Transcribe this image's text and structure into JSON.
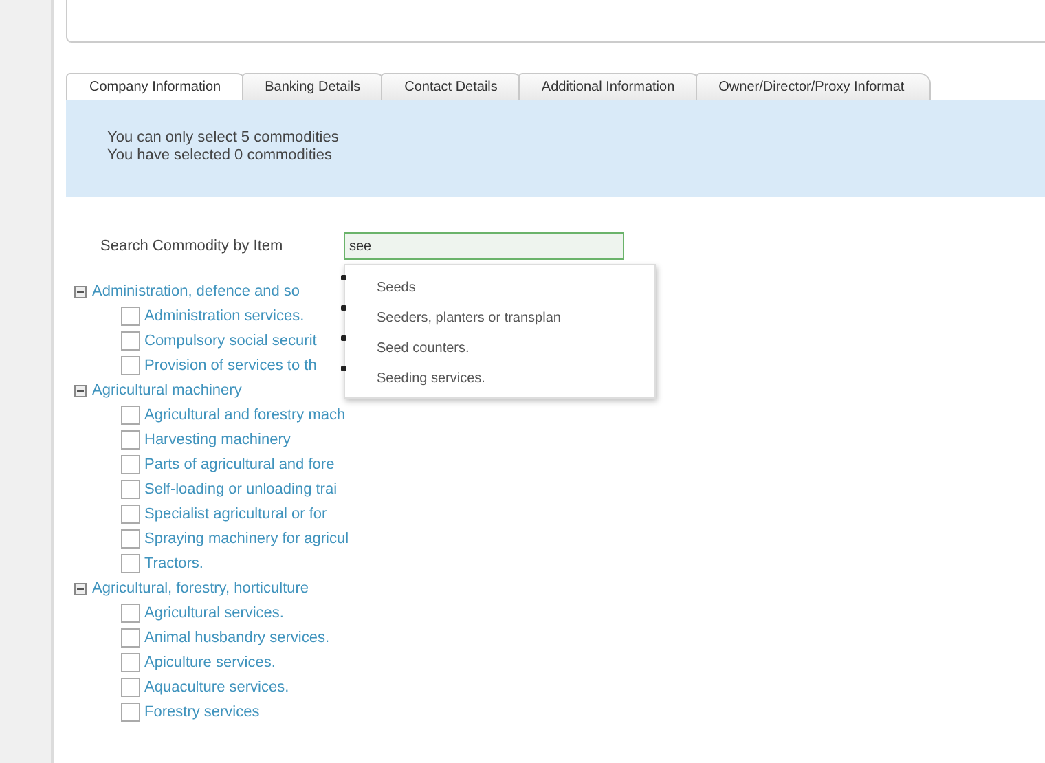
{
  "tabs": [
    {
      "label": "Company Information",
      "selected": true
    },
    {
      "label": "Banking Details",
      "selected": false
    },
    {
      "label": "Contact Details",
      "selected": false
    },
    {
      "label": "Additional Information",
      "selected": false
    },
    {
      "label": "Owner/Director/Proxy Informat",
      "selected": false
    }
  ],
  "info": [
    "You can only select 5 commodities",
    "You have selected 0 commodities"
  ],
  "search": {
    "label": "Search Commodity by Item",
    "value": "see"
  },
  "suggestions": [
    "Seeds",
    "Seeders, planters or transplan",
    "Seed counters.",
    "Seeding services."
  ],
  "tree": [
    {
      "label": "Administration, defence and so",
      "expanded": true,
      "children": [
        {
          "label": "Administration services.",
          "checked": false
        },
        {
          "label": "Compulsory social securit",
          "checked": false
        },
        {
          "label": "Provision of services to th",
          "checked": false
        }
      ]
    },
    {
      "label": "Agricultural machinery",
      "expanded": true,
      "children": [
        {
          "label": "Agricultural and forestry mach",
          "checked": false
        },
        {
          "label": "Harvesting machinery",
          "checked": false
        },
        {
          "label": "Parts of agricultural and fore",
          "checked": false
        },
        {
          "label": "Self-loading or unloading trai",
          "checked": false
        },
        {
          "label": "Specialist agricultural or for",
          "checked": false
        },
        {
          "label": "Spraying machinery for agricul",
          "checked": false
        },
        {
          "label": "Tractors.",
          "checked": false
        }
      ]
    },
    {
      "label": "Agricultural, forestry, horticulture",
      "expanded": true,
      "children": [
        {
          "label": "Agricultural services.",
          "checked": false
        },
        {
          "label": "Animal husbandry services.",
          "checked": false
        },
        {
          "label": "Apiculture services.",
          "checked": false
        },
        {
          "label": "Aquaculture services.",
          "checked": false
        },
        {
          "label": "Forestry services",
          "checked": false
        }
      ]
    }
  ]
}
